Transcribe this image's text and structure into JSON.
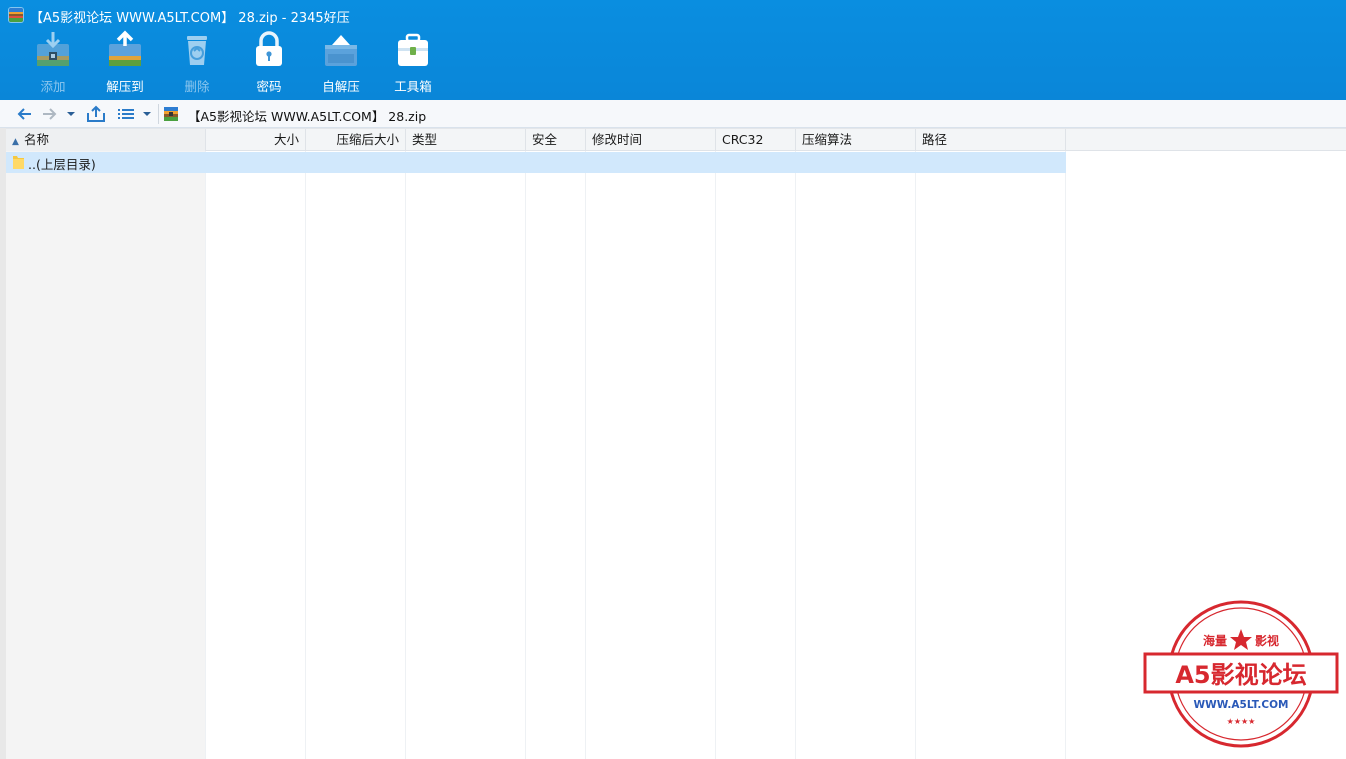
{
  "window": {
    "title": "【A5影视论坛 WWW.A5LT.COM】 28.zip - 2345好压"
  },
  "toolbar": {
    "add": "添加",
    "extract_to": "解压到",
    "delete": "删除",
    "password": "密码",
    "self_extract": "自解压",
    "toolbox": "工具箱"
  },
  "address": {
    "path": "【A5影视论坛 WWW.A5LT.COM】 28.zip"
  },
  "columns": {
    "name": "名称",
    "size": "大小",
    "packed_size": "压缩后大小",
    "type": "类型",
    "security": "安全",
    "modified": "修改时间",
    "crc": "CRC32",
    "method": "压缩算法",
    "path": "路径"
  },
  "rows": [
    {
      "name": "..(上层目录)"
    }
  ],
  "watermark": {
    "top_left": "海量",
    "top_right": "影视",
    "main": "A5影视论坛",
    "url": "WWW.A5LT.COM"
  },
  "colors": {
    "ribbon": "#0a8ee0",
    "selected_row": "#d1e8fc",
    "stamp_red": "#d7282f"
  }
}
